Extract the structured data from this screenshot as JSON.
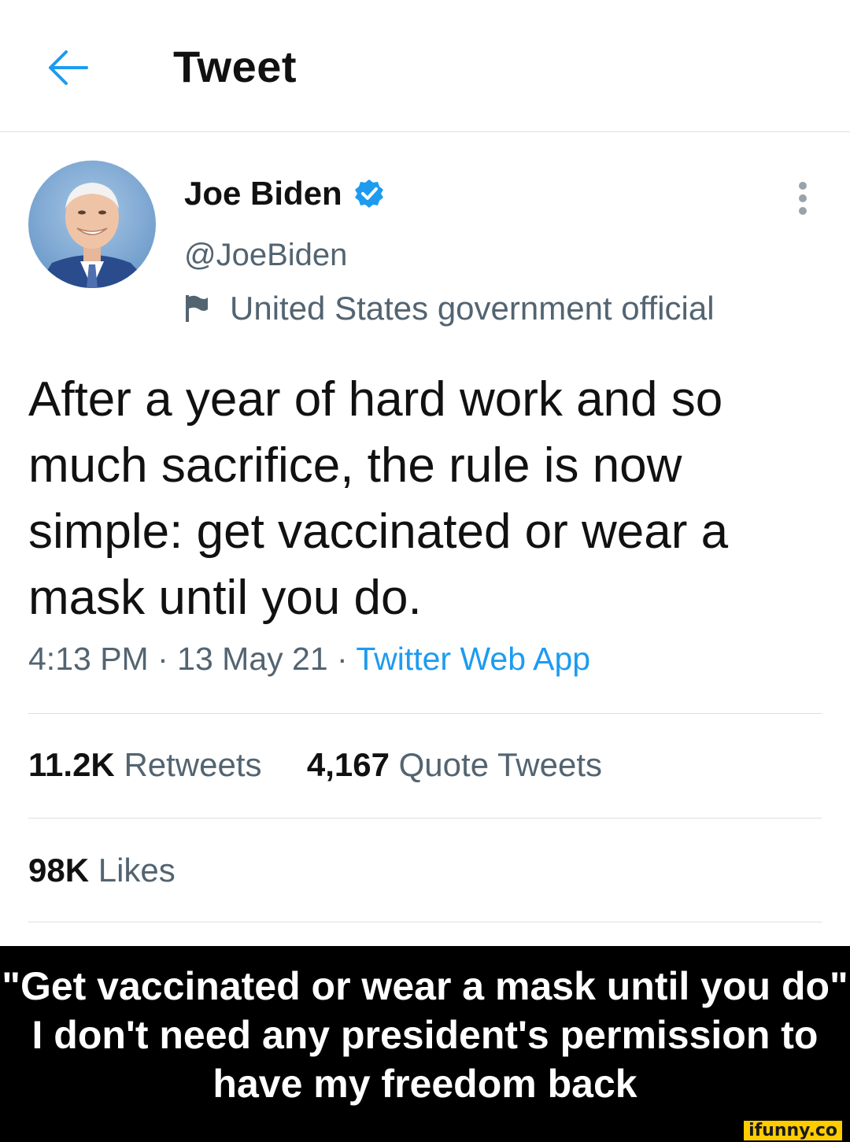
{
  "header": {
    "title": "Tweet",
    "back_icon": "arrow-left-icon"
  },
  "author": {
    "name": "Joe Biden",
    "handle": "@JoeBiden",
    "label": "United States government official",
    "verified_icon": "verified-badge-icon",
    "label_icon": "flag-icon"
  },
  "tweet": {
    "text": "After a year of hard work and so much sacrifice, the rule is now simple: get vaccinated or wear a mask until you do.",
    "time": "4:13 PM",
    "date": "13 May 21",
    "source": "Twitter Web App",
    "separator": "·"
  },
  "stats": {
    "retweets_count": "11.2K",
    "retweets_label": "Retweets",
    "quotes_count": "4,167",
    "quotes_label": "Quote Tweets",
    "likes_count": "98K",
    "likes_label": "Likes"
  },
  "caption": {
    "line1": "\"Get vaccinated or wear a mask until you do\"",
    "line2": "I don't need any president's permission to",
    "line3": "have my freedom back"
  },
  "watermark": "ifunny.co",
  "colors": {
    "accent": "#1d9bf0",
    "secondary_text": "#536471",
    "caption_bg": "#000000"
  }
}
